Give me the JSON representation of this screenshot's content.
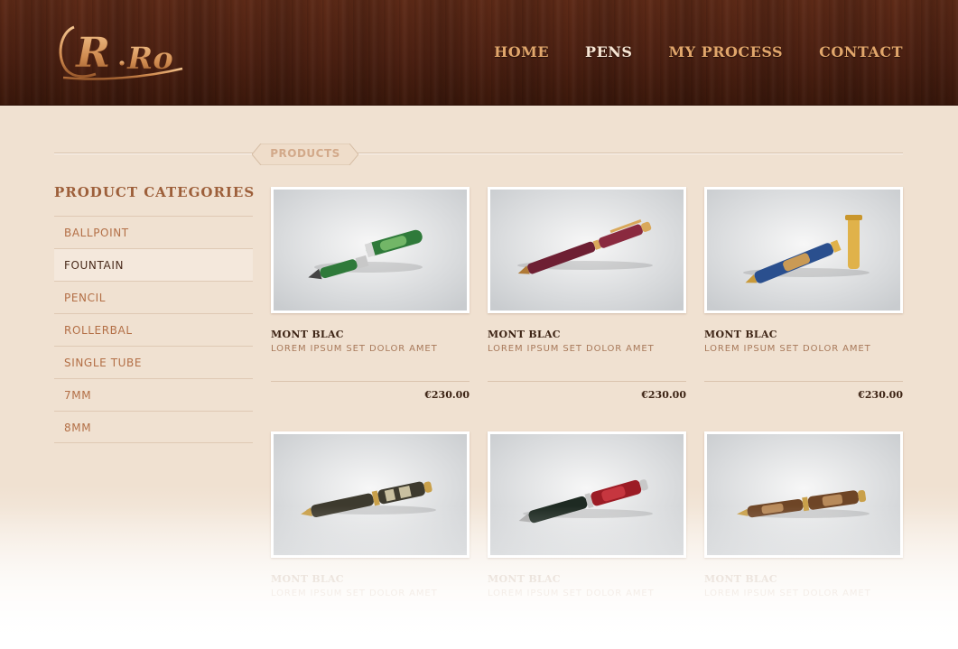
{
  "header": {
    "logo_text": "R.Ro",
    "nav": [
      {
        "label": "HOME",
        "active": false
      },
      {
        "label": "PENS",
        "active": true
      },
      {
        "label": "MY PROCESS",
        "active": false
      },
      {
        "label": "CONTACT",
        "active": false
      }
    ]
  },
  "section": {
    "label": "PRODUCTS"
  },
  "sidebar": {
    "title": "PRODUCT CATEGORIES",
    "items": [
      {
        "label": "BALLPOINT",
        "active": false
      },
      {
        "label": "FOUNTAIN",
        "active": true
      },
      {
        "label": "PENCIL",
        "active": false
      },
      {
        "label": "ROLLERBAL",
        "active": false
      },
      {
        "label": "SINGLE TUBE",
        "active": false
      },
      {
        "label": "7MM",
        "active": false
      },
      {
        "label": "8MM",
        "active": false
      }
    ]
  },
  "products": [
    {
      "name": "MONT BLAC",
      "desc": "LOREM IPSUM SET DOLOR AMET",
      "price": "€230.00",
      "image": "green-fountain-pen",
      "colors": [
        "#2f7a3a",
        "#8fd07a"
      ]
    },
    {
      "name": "MONT BLAC",
      "desc": "LOREM IPSUM SET DOLOR AMET",
      "price": "€230.00",
      "image": "burgundy-ballpoint-pen",
      "colors": [
        "#6e1f33",
        "#b04a5c"
      ]
    },
    {
      "name": "MONT BLAC",
      "desc": "LOREM IPSUM SET DOLOR AMET",
      "price": "€230.00",
      "image": "blue-burl-pen",
      "colors": [
        "#2a4f8e",
        "#c99a55"
      ]
    },
    {
      "name": "MONT BLAC",
      "desc": "LOREM IPSUM SET DOLOR AMET",
      "price": "",
      "image": "camo-ballpoint-pen",
      "colors": [
        "#3d3a2e",
        "#c9c0a0"
      ]
    },
    {
      "name": "MONT BLAC",
      "desc": "LOREM IPSUM SET DOLOR AMET",
      "price": "",
      "image": "red-ballpoint-pen",
      "colors": [
        "#9c1c25",
        "#d9424a"
      ]
    },
    {
      "name": "MONT BLAC",
      "desc": "LOREM IPSUM SET DOLOR AMET",
      "price": "",
      "image": "wood-pencil",
      "colors": [
        "#6e4526",
        "#b88a5a"
      ]
    }
  ]
}
